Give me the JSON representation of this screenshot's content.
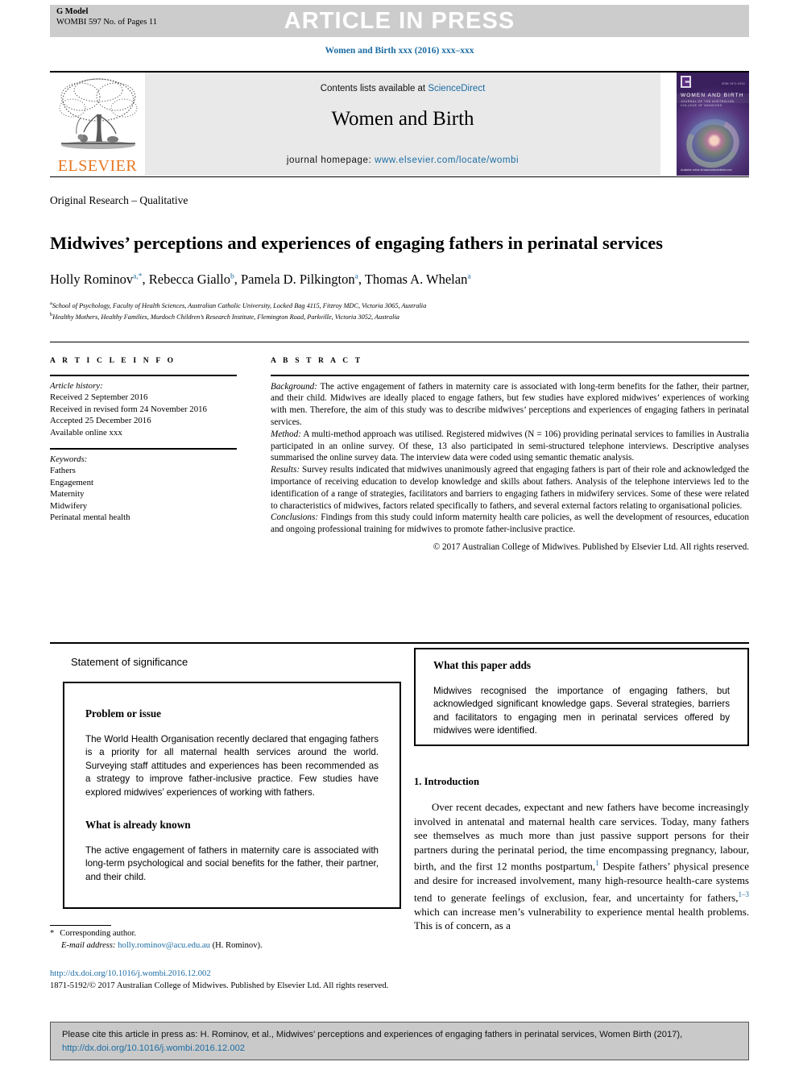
{
  "header": {
    "g_model": "G Model",
    "g_model_sub": "WOMBI 597 No. of Pages 11",
    "article_in_press": "ARTICLE IN PRESS",
    "journal_ref": "Women and Birth xxx (2016) xxx–xxx"
  },
  "masthead": {
    "contents_prefix": "Contents lists available at",
    "sciencedirect": "ScienceDirect",
    "journal_title": "Women and Birth",
    "homepage_label": "journal homepage:",
    "homepage_url": "www.elsevier.com/locate/wombi",
    "publisher": "ELSEVIER",
    "cover_title": "WOMEN AND BIRTH",
    "cover_sub": "JOURNAL OF THE AUSTRALIAN COLLEGE OF MIDWIVES",
    "cover_topright": "ISSN 1871-5192",
    "cover_footer": "Available online at\nwww.sciencedirect.com"
  },
  "article": {
    "section_kind": "Original Research – Qualitative",
    "title": "Midwives’ perceptions and experiences of engaging fathers in perinatal services",
    "authors": [
      {
        "name": "Holly Rominov",
        "marks": "a,*"
      },
      {
        "name": "Rebecca Giallo",
        "marks": "b"
      },
      {
        "name": "Pamela D. Pilkington",
        "marks": "a"
      },
      {
        "name": "Thomas A. Whelan",
        "marks": "a"
      }
    ],
    "affiliations": [
      {
        "mark": "a",
        "text": "School of Psychology, Faculty of Health Sciences, Australian Catholic University, Locked Bag 4115, Fitzroy MDC, Victoria 3065, Australia"
      },
      {
        "mark": "b",
        "text": "Healthy Mothers, Healthy Families, Murdoch Children’s Research Institute, Flemington Road, Parkville, Victoria 3052, Australia"
      }
    ]
  },
  "article_info": {
    "heading": "A R T I C L E    I N F O",
    "history_label": "Article history:",
    "history": [
      "Received 2 September 2016",
      "Received in revised form 24 November 2016",
      "Accepted 25 December 2016",
      "Available online xxx"
    ],
    "keywords_label": "Keywords:",
    "keywords": [
      "Fathers",
      "Engagement",
      "Maternity",
      "Midwifery",
      "Perinatal mental health"
    ]
  },
  "abstract": {
    "heading": "A B S T R A C T",
    "background_label": "Background:",
    "background": "The active engagement of fathers in maternity care is associated with long-term benefits for the father, their partner, and their child. Midwives are ideally placed to engage fathers, but few studies have explored midwives’ experiences of working with men. Therefore, the aim of this study was to describe midwives’ perceptions and experiences of engaging fathers in perinatal services.",
    "method_label": "Method:",
    "method": "A multi-method approach was utilised. Registered midwives (N = 106) providing perinatal services to families in Australia participated in an online survey. Of these, 13 also participated in semi-structured telephone interviews. Descriptive analyses summarised the online survey data. The interview data were coded using semantic thematic analysis.",
    "results_label": "Results:",
    "results": "Survey results indicated that midwives unanimously agreed that engaging fathers is part of their role and acknowledged the importance of receiving education to develop knowledge and skills about fathers. Analysis of the telephone interviews led to the identification of a range of strategies, facilitators and barriers to engaging fathers in midwifery services. Some of these were related to characteristics of midwives, factors related specifically to fathers, and several external factors relating to organisational policies.",
    "conclusions_label": "Conclusions:",
    "conclusions": "Findings from this study could inform maternity health care policies, as well the development of resources, education and ongoing professional training for midwives to promote father-inclusive practice.",
    "copyright": "© 2017 Australian College of Midwives. Published by Elsevier Ltd. All rights reserved."
  },
  "significance": {
    "title": "Statement of significance",
    "blocks": [
      {
        "heading": "Problem or issue",
        "text": "The World Health Organisation recently declared that engaging fathers is a priority for all maternal health services around the world. Surveying staff attitudes and experiences has been recommended as a strategy to improve father-inclusive practice. Few studies have explored midwives’ experiences of working with fathers."
      },
      {
        "heading": "What is already known",
        "text": "The active engagement of fathers in maternity care is associated with long-term psychological and social benefits for the father, their partner, and their child."
      }
    ],
    "adds": {
      "heading": "What this paper adds",
      "text": "Midwives recognised the importance of engaging fathers, but acknowledged significant knowledge gaps. Several strategies, barriers and facilitators to engaging men in perinatal services offered by midwives were identified."
    }
  },
  "introduction": {
    "heading": "1. Introduction",
    "paragraph_1": "Over recent decades, expectant and new fathers have become increasingly involved in antenatal and maternal health care services. Today, many fathers see themselves as much more than just passive support persons for their partners during the perinatal period, the time encompassing pregnancy, labour, birth, and the first 12 months postpartum,",
    "ref_1": "1",
    "paragraph_1b": " Despite fathers’ physical presence and desire for increased involvement, many high-resource health-care systems tend to generate feelings of exclusion, fear, and uncertainty for fathers,",
    "ref_2": "1–3",
    "paragraph_1c": " which can increase men’s vulnerability to experience mental health problems. This is of concern, as a"
  },
  "footnotes": {
    "corresponding_star": "*",
    "corresponding": "Corresponding author.",
    "email_label": "E-mail address:",
    "email": "holly.rominov@acu.edu.au",
    "email_owner": "(H. Rominov).",
    "doi_url": "http://dx.doi.org/10.1016/j.wombi.2016.12.002",
    "issn_line": "1871-5192/© 2017 Australian College of Midwives. Published by Elsevier Ltd. All rights reserved."
  },
  "cite_box": {
    "prefix": "Please cite this article in press as: H. Rominov, et al., Midwives’ perceptions and experiences of engaging fathers in perinatal services, Women Birth (2017),",
    "link": "http://dx.doi.org/10.1016/j.wombi.2016.12.002"
  },
  "colors": {
    "link": "#1b6ca3",
    "elsevier_orange": "#e87722",
    "topbar_grey": "#cccccc",
    "masthead_grey": "#e9e9e9",
    "cite_grey": "#c9c9c9"
  }
}
